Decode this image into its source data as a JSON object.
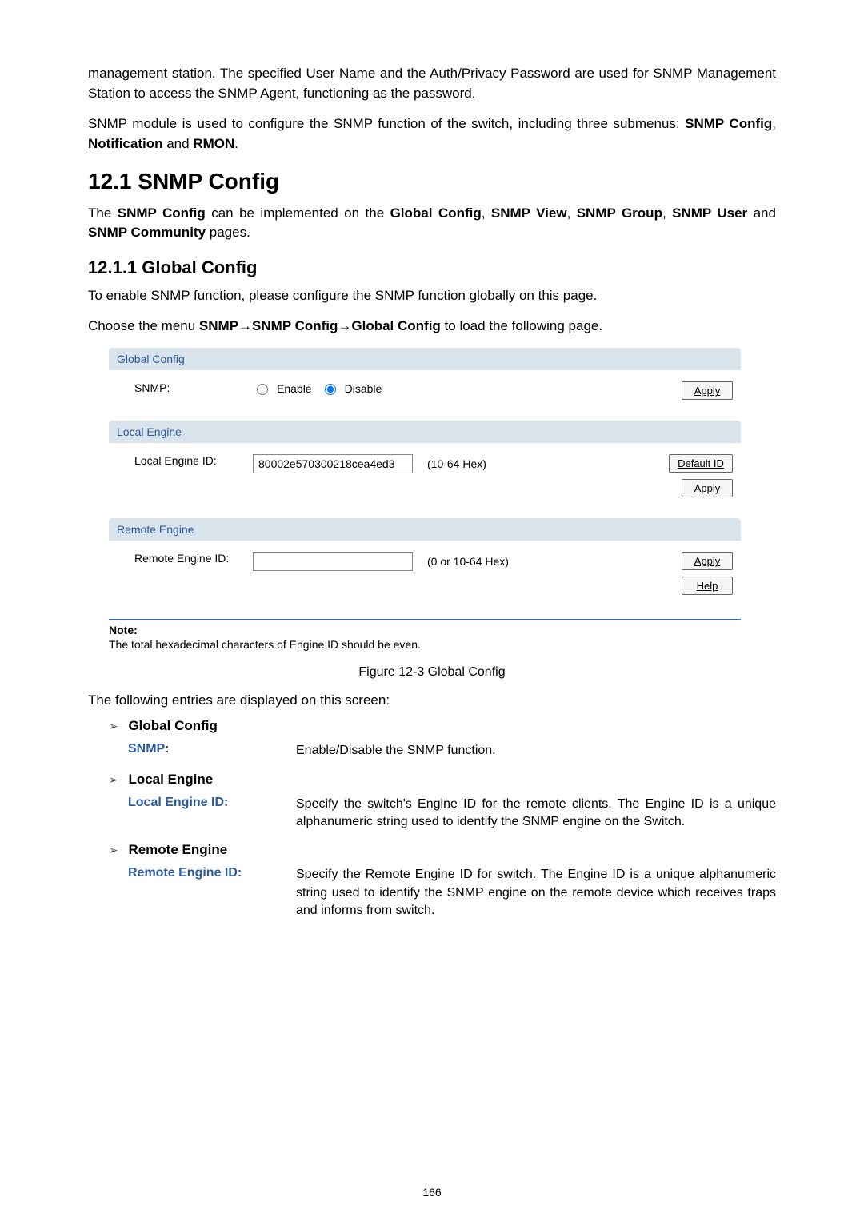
{
  "intro": {
    "p1": "management station. The specified User Name and the Auth/Privacy Password are used for SNMP Management Station to access the SNMP Agent, functioning as the password.",
    "p2_pre": "SNMP module is used to configure the SNMP function of the switch, including three submenus: ",
    "p2_b1": "SNMP Config",
    "p2_mid1": ", ",
    "p2_b2": "Notification",
    "p2_mid2": " and ",
    "p2_b3": "RMON",
    "p2_end": "."
  },
  "h2": "12.1 SNMP Config",
  "sec1_p_pre": "The ",
  "sec1_b1": "SNMP Config",
  "sec1_mid1": " can be implemented on the ",
  "sec1_b2": "Global Config",
  "sec1_mid2": ", ",
  "sec1_b3": "SNMP View",
  "sec1_mid3": ", ",
  "sec1_b4": "SNMP Group",
  "sec1_mid4": ", ",
  "sec1_b5": "SNMP User",
  "sec1_mid5": " and ",
  "sec1_b6": "SNMP Community",
  "sec1_end": " pages.",
  "h3": "12.1.1  Global Config",
  "p_enable": "To enable SNMP function, please configure the SNMP function globally on this page.",
  "p_menu_pre": "Choose the menu ",
  "p_menu_path": "SNMP→SNMP Config→Global Config",
  "p_menu_end": " to load the following page.",
  "panel": {
    "global": {
      "head": "Global Config",
      "label": "SNMP:",
      "opt_enable": "Enable",
      "opt_disable": "Disable",
      "selected": "disable",
      "apply": "Apply"
    },
    "local": {
      "head": "Local Engine",
      "label": "Local Engine ID:",
      "value": "80002e570300218cea4ed3",
      "hint": "(10-64 Hex)",
      "default_btn": "Default ID",
      "apply": "Apply"
    },
    "remote": {
      "head": "Remote Engine",
      "label": "Remote Engine ID:",
      "value": "",
      "hint": "(0 or 10-64 Hex)",
      "apply": "Apply",
      "help": "Help"
    }
  },
  "note": {
    "title": "Note:",
    "text": "The total hexadecimal characters of Engine ID should be even."
  },
  "fig_caption": "Figure 12-3 Global Config",
  "entries_intro": "The following entries are displayed on this screen:",
  "groups": {
    "g1": {
      "title": "Global Config",
      "term": "SNMP:",
      "desc": "Enable/Disable the SNMP function."
    },
    "g2": {
      "title": "Local Engine",
      "term": "Local Engine ID:",
      "desc": "Specify the switch's Engine ID for the remote clients. The Engine ID is a unique alphanumeric string used to identify the SNMP engine on the Switch."
    },
    "g3": {
      "title": "Remote Engine",
      "term": "Remote Engine ID:",
      "desc": "Specify the Remote Engine ID for switch. The Engine ID is a unique alphanumeric string used to identify the SNMP engine on the remote device which receives traps and informs from switch."
    }
  },
  "arrow": "➢",
  "page_num": "166"
}
